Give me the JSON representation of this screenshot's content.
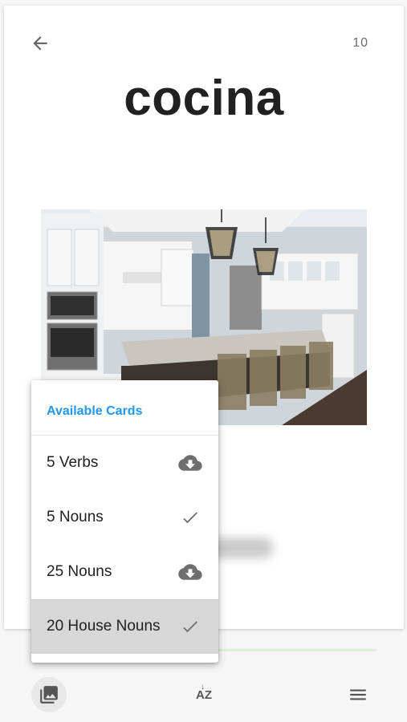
{
  "header": {
    "back_icon": "arrow-left-icon",
    "card_count": "10"
  },
  "card": {
    "word": "cocina",
    "image_subject": "kitchen"
  },
  "popup": {
    "title": "Available Cards",
    "items": [
      {
        "label": "5 Verbs",
        "status_icon": "cloud-download-icon",
        "selected": false
      },
      {
        "label": "5 Nouns",
        "status_icon": "check-icon",
        "selected": false
      },
      {
        "label": "25 Nouns",
        "status_icon": "cloud-download-icon",
        "selected": false
      },
      {
        "label": "20 House Nouns",
        "status_icon": "check-icon",
        "selected": true
      }
    ]
  },
  "toolbar": {
    "gallery_icon": "image-gallery-icon",
    "sort_icon": "sort-az-icon",
    "sort_glyph": "AZ",
    "menu_icon": "hamburger-menu-icon"
  },
  "colors": {
    "accent": "#2196f3",
    "selected_row": "#d7d7d7",
    "progress_track": "#dcefdc"
  }
}
